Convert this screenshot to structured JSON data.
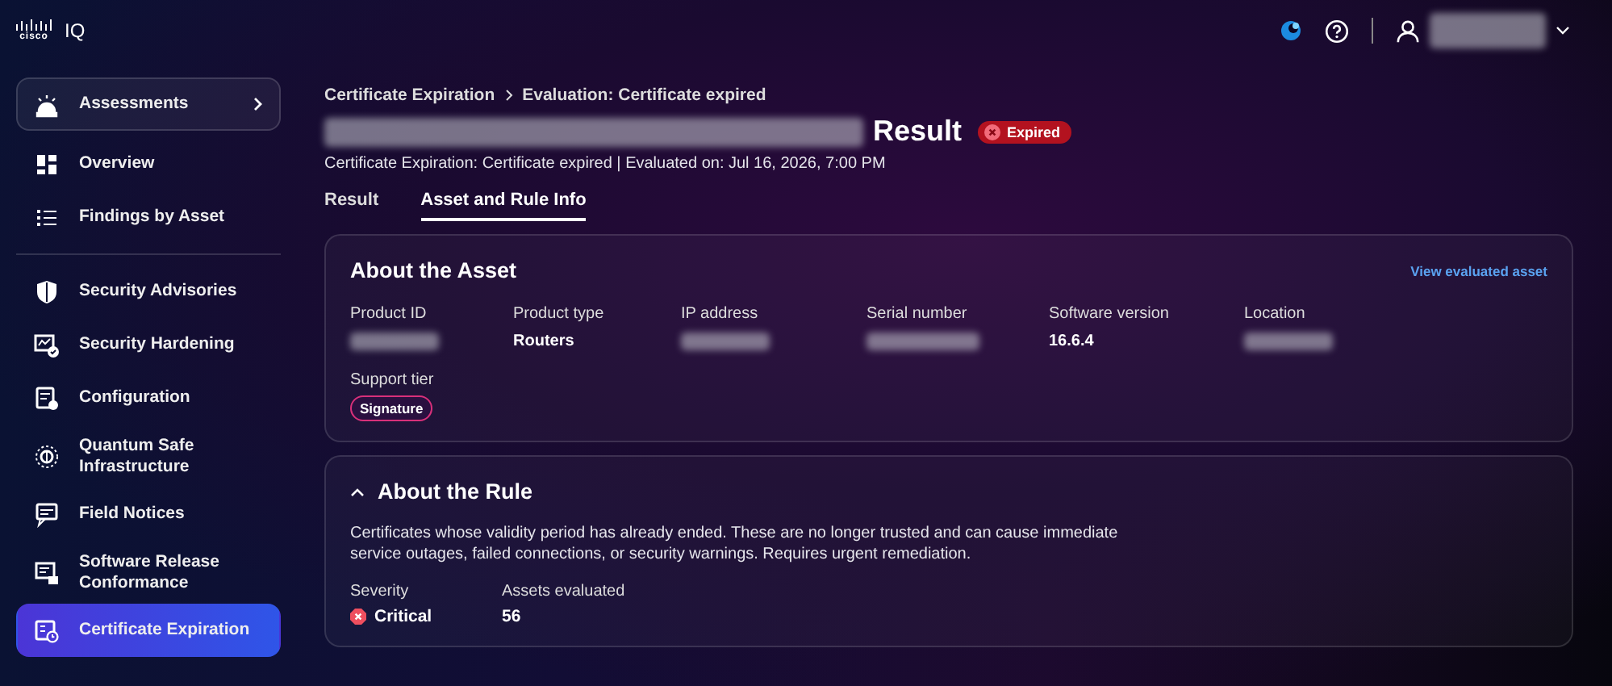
{
  "header": {
    "brand": "cisco",
    "product": "IQ",
    "user": {
      "name_redacted": true
    }
  },
  "sidebar": {
    "sections": [
      {
        "items": [
          {
            "label": "Assessments",
            "kind": "group",
            "selected": false
          },
          {
            "label": "Overview",
            "kind": "item",
            "selected": false
          },
          {
            "label": "Findings by Asset",
            "kind": "item",
            "selected": false
          }
        ]
      },
      {
        "items": [
          {
            "label": "Security Advisories",
            "kind": "item",
            "selected": false
          },
          {
            "label": "Security Hardening",
            "kind": "item",
            "selected": false
          },
          {
            "label": "Configuration",
            "kind": "item",
            "selected": false
          },
          {
            "label": "Quantum Safe Infrastructure",
            "kind": "item",
            "selected": false
          },
          {
            "label": "Field Notices",
            "kind": "item",
            "selected": false
          },
          {
            "label": "Software Release Conformance",
            "kind": "item",
            "selected": false
          },
          {
            "label": "Certificate Expiration",
            "kind": "item",
            "selected": true
          }
        ]
      }
    ]
  },
  "breadcrumb": [
    "Certificate Expiration",
    "Evaluation: Certificate expired"
  ],
  "title": {
    "id_redacted": true,
    "text": "Result",
    "status": "Expired"
  },
  "subtitle": "Certificate Expiration: Certificate expired | Evaluated on: Jul 16, 2026, 7:00 PM",
  "tabs": [
    {
      "label": "Result",
      "selected": false
    },
    {
      "label": "Asset and Rule Info",
      "selected": true
    }
  ],
  "asset": {
    "title": "About the Asset",
    "link": "View evaluated asset",
    "fields": [
      {
        "label": "Product ID",
        "redacted": true
      },
      {
        "label": "Product type",
        "value": "Routers",
        "redacted": false
      },
      {
        "label": "IP address",
        "redacted": true
      },
      {
        "label": "Serial number",
        "redacted": true
      },
      {
        "label": "Software version",
        "value": "16.6.4",
        "redacted": false
      },
      {
        "label": "Location",
        "redacted": true
      }
    ],
    "support_tier": {
      "label": "Support tier",
      "value": "Signature"
    }
  },
  "rule": {
    "title": "About the Rule",
    "expanded": true,
    "description": "Certificates whose validity period has already ended. These are no longer trusted and can cause immediate service outages, failed connections, or security warnings. Requires urgent remediation.",
    "stats": [
      {
        "label": "Severity",
        "value": "Critical",
        "kind": "severity"
      },
      {
        "label": "Assets evaluated",
        "value": "56",
        "kind": "count"
      }
    ]
  }
}
